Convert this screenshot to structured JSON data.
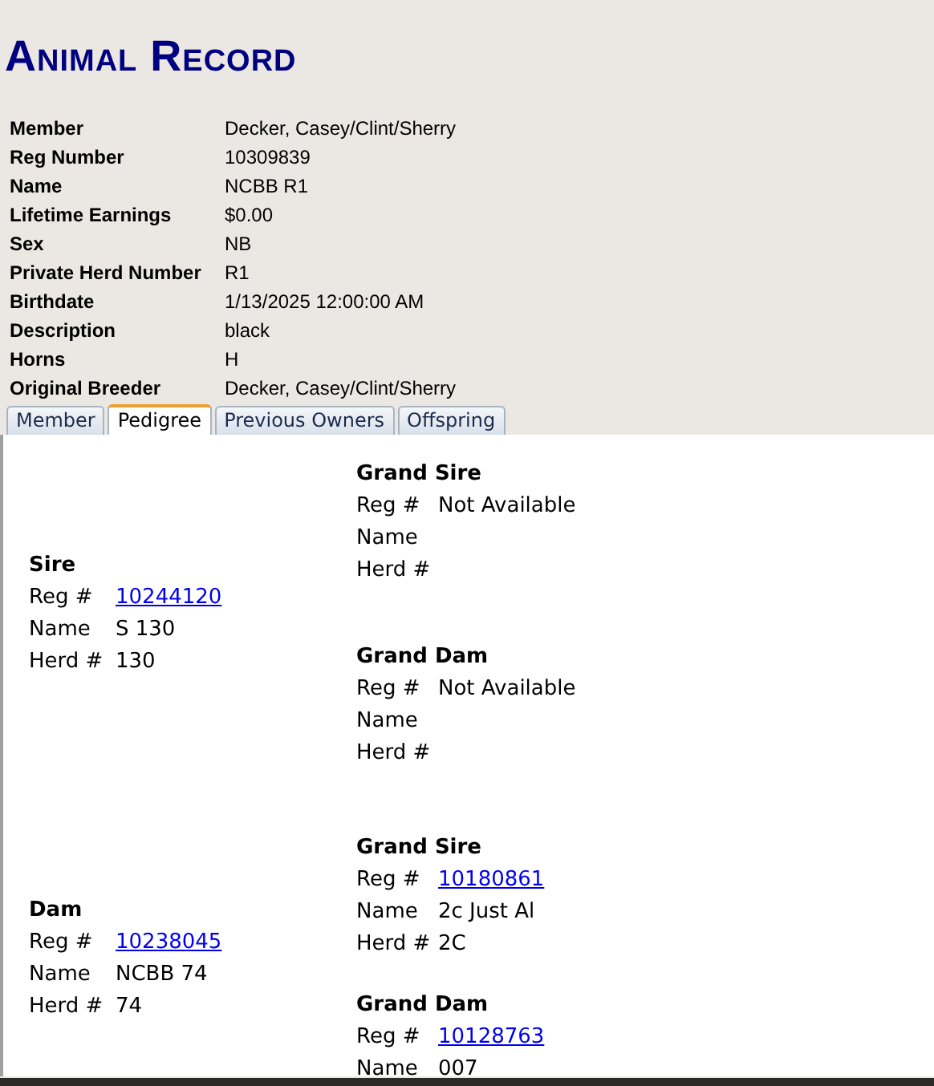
{
  "title": "Animal Record",
  "details": [
    {
      "label": "Member",
      "value": "Decker, Casey/Clint/Sherry"
    },
    {
      "label": "Reg Number",
      "value": "10309839"
    },
    {
      "label": "Name",
      "value": "NCBB R1"
    },
    {
      "label": "Lifetime Earnings",
      "value": "$0.00"
    },
    {
      "label": "Sex",
      "value": "NB"
    },
    {
      "label": "Private Herd Number",
      "value": "R1"
    },
    {
      "label": "Birthdate",
      "value": "1/13/2025 12:00:00 AM"
    },
    {
      "label": "Description",
      "value": "black"
    },
    {
      "label": "Horns",
      "value": "H"
    },
    {
      "label": "Original Breeder",
      "value": "Decker, Casey/Clint/Sherry"
    }
  ],
  "tabs": [
    {
      "label": "Member",
      "selected": false
    },
    {
      "label": "Pedigree",
      "selected": true
    },
    {
      "label": "Previous Owners",
      "selected": false
    },
    {
      "label": "Offspring",
      "selected": false
    }
  ],
  "pedigree": [
    {
      "heading": "Sire",
      "fields": [
        {
          "label": "Reg #",
          "value": "10244120",
          "kind": "link"
        },
        {
          "label": "Name",
          "value": "S 130",
          "kind": "text"
        },
        {
          "label": "Herd #",
          "value": "130",
          "kind": "text"
        }
      ],
      "grandparents": [
        {
          "heading": "Grand Sire",
          "fields": [
            {
              "label": "Reg #",
              "value": "Not Available",
              "kind": "text"
            },
            {
              "label": "Name"
            },
            {
              "label": "Herd #"
            }
          ]
        },
        {
          "heading": "Grand Dam",
          "fields": [
            {
              "label": "Reg #",
              "value": "Not Available",
              "kind": "text"
            },
            {
              "label": "Name"
            },
            {
              "label": "Herd #"
            }
          ]
        }
      ]
    },
    {
      "heading": "Dam",
      "fields": [
        {
          "label": "Reg #",
          "value": "10238045",
          "kind": "link"
        },
        {
          "label": "Name",
          "value": "NCBB 74",
          "kind": "text"
        },
        {
          "label": "Herd #",
          "value": "74",
          "kind": "text"
        }
      ],
      "grandparents": [
        {
          "heading": "Grand Sire",
          "fields": [
            {
              "label": "Reg #",
              "value": "10180861",
              "kind": "link"
            },
            {
              "label": "Name",
              "value": "2c Just Al",
              "kind": "text"
            },
            {
              "label": "Herd #",
              "value": "2C",
              "kind": "text"
            }
          ]
        },
        {
          "heading": "Grand Dam",
          "fields": [
            {
              "label": "Reg #",
              "value": "10128763",
              "kind": "link"
            },
            {
              "label": "Name",
              "value": "007",
              "kind": "text"
            }
          ]
        }
      ]
    }
  ]
}
